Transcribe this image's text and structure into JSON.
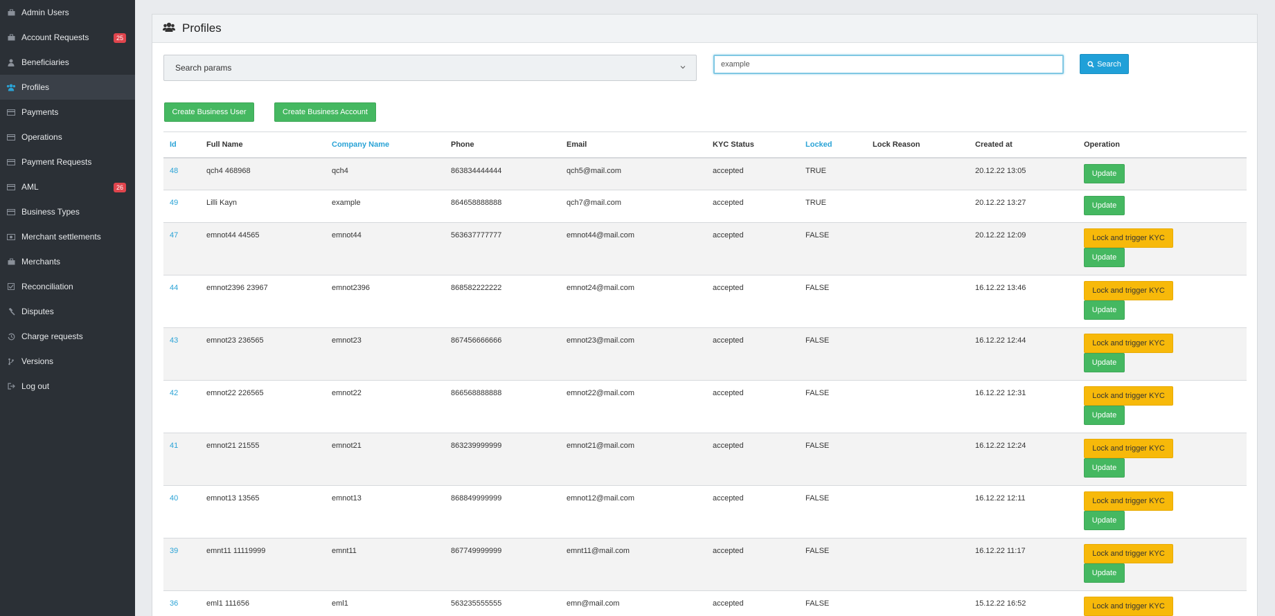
{
  "sidebar": {
    "items": [
      {
        "label": "Admin Users",
        "icon": "briefcase-icon",
        "badge": ""
      },
      {
        "label": "Account Requests",
        "icon": "briefcase-icon",
        "badge": "25"
      },
      {
        "label": "Beneficiaries",
        "icon": "user-icon",
        "badge": ""
      },
      {
        "label": "Profiles",
        "icon": "users-icon",
        "badge": ""
      },
      {
        "label": "Payments",
        "icon": "credit-card-icon",
        "badge": ""
      },
      {
        "label": "Operations",
        "icon": "credit-card-icon",
        "badge": ""
      },
      {
        "label": "Payment Requests",
        "icon": "credit-card-icon",
        "badge": ""
      },
      {
        "label": "AML",
        "icon": "credit-card-icon",
        "badge": "26"
      },
      {
        "label": "Business Types",
        "icon": "credit-card-icon",
        "badge": ""
      },
      {
        "label": "Merchant settlements",
        "icon": "money-icon",
        "badge": ""
      },
      {
        "label": "Merchants",
        "icon": "briefcase-icon",
        "badge": ""
      },
      {
        "label": "Reconciliation",
        "icon": "check-square-icon",
        "badge": ""
      },
      {
        "label": "Disputes",
        "icon": "gavel-icon",
        "badge": ""
      },
      {
        "label": "Charge requests",
        "icon": "history-icon",
        "badge": ""
      },
      {
        "label": "Versions",
        "icon": "branch-icon",
        "badge": ""
      },
      {
        "label": "Log out",
        "icon": "sign-out-icon",
        "badge": ""
      }
    ],
    "active_index": 3
  },
  "panel": {
    "title": "Profiles",
    "title_icon": "users-icon"
  },
  "search": {
    "params_label": "Search params",
    "input_value": "example",
    "button_label": "Search"
  },
  "actions": {
    "create_user": "Create Business User",
    "create_account": "Create Business Account"
  },
  "table": {
    "headers": {
      "id": "Id",
      "full_name": "Full Name",
      "company": "Company Name",
      "phone": "Phone",
      "email": "Email",
      "kyc": "KYC Status",
      "locked": "Locked",
      "lock_reason": "Lock Reason",
      "created": "Created at",
      "operation": "Operation"
    },
    "lock_label": "Lock and trigger KYC",
    "update_label": "Update",
    "rows": [
      {
        "id": "48",
        "full_name": "qch4 468968",
        "company": "qch4",
        "phone": "863834444444",
        "email": "qch5@mail.com",
        "kyc": "accepted",
        "locked": "TRUE",
        "lock_reason": "",
        "created": "20.12.22 13:05",
        "can_lock": false
      },
      {
        "id": "49",
        "full_name": "Lilli Kayn",
        "company": "example",
        "phone": "864658888888",
        "email": "qch7@mail.com",
        "kyc": "accepted",
        "locked": "TRUE",
        "lock_reason": "",
        "created": "20.12.22 13:27",
        "can_lock": false
      },
      {
        "id": "47",
        "full_name": "emnot44 44565",
        "company": "emnot44",
        "phone": "563637777777",
        "email": "emnot44@mail.com",
        "kyc": "accepted",
        "locked": "FALSE",
        "lock_reason": "",
        "created": "20.12.22 12:09",
        "can_lock": true
      },
      {
        "id": "44",
        "full_name": "emnot2396 23967",
        "company": "emnot2396",
        "phone": "868582222222",
        "email": "emnot24@mail.com",
        "kyc": "accepted",
        "locked": "FALSE",
        "lock_reason": "",
        "created": "16.12.22 13:46",
        "can_lock": true
      },
      {
        "id": "43",
        "full_name": "emnot23 236565",
        "company": "emnot23",
        "phone": "867456666666",
        "email": "emnot23@mail.com",
        "kyc": "accepted",
        "locked": "FALSE",
        "lock_reason": "",
        "created": "16.12.22 12:44",
        "can_lock": true
      },
      {
        "id": "42",
        "full_name": "emnot22 226565",
        "company": "emnot22",
        "phone": "866568888888",
        "email": "emnot22@mail.com",
        "kyc": "accepted",
        "locked": "FALSE",
        "lock_reason": "",
        "created": "16.12.22 12:31",
        "can_lock": true
      },
      {
        "id": "41",
        "full_name": "emnot21 21555",
        "company": "emnot21",
        "phone": "863239999999",
        "email": "emnot21@mail.com",
        "kyc": "accepted",
        "locked": "FALSE",
        "lock_reason": "",
        "created": "16.12.22 12:24",
        "can_lock": true
      },
      {
        "id": "40",
        "full_name": "emnot13 13565",
        "company": "emnot13",
        "phone": "868849999999",
        "email": "emnot12@mail.com",
        "kyc": "accepted",
        "locked": "FALSE",
        "lock_reason": "",
        "created": "16.12.22 12:11",
        "can_lock": true
      },
      {
        "id": "39",
        "full_name": "emnt11 11119999",
        "company": "emnt11",
        "phone": "867749999999",
        "email": "emnt11@mail.com",
        "kyc": "accepted",
        "locked": "FALSE",
        "lock_reason": "",
        "created": "16.12.22 11:17",
        "can_lock": true
      },
      {
        "id": "36",
        "full_name": "eml1 111656",
        "company": "eml1",
        "phone": "563235555555",
        "email": "emn@mail.com",
        "kyc": "accepted",
        "locked": "FALSE",
        "lock_reason": "",
        "created": "15.12.22 16:52",
        "can_lock": true
      }
    ]
  },
  "colors": {
    "sidebar_bg": "#2b3036",
    "link": "#2aa3d6",
    "green": "#45b861",
    "yellow": "#f7b90a",
    "badge": "#e0454d"
  }
}
